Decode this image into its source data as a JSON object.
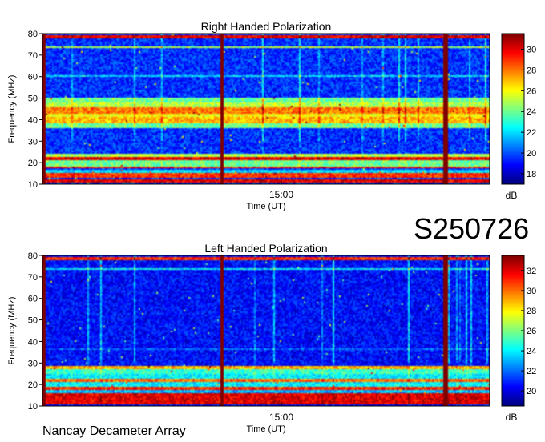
{
  "station_code": "S250726",
  "instrument": "Nancay Decameter Array",
  "chart_data": [
    {
      "type": "heatmap",
      "title": "Right Handed Polarization",
      "xlabel": "Time (UT)",
      "ylabel": "Frequency (MHz)",
      "x_ticks": [
        "15:00"
      ],
      "ylim": [
        10,
        80
      ],
      "y_ticks": [
        10,
        20,
        30,
        40,
        50,
        60,
        70,
        80
      ],
      "colorbar": {
        "label": "dB",
        "ticks": [
          18,
          20,
          22,
          24,
          26,
          28,
          30
        ],
        "range": [
          17,
          31.5
        ]
      },
      "bands": [
        {
          "freq": [
            10.5,
            12.5
          ],
          "level": 30
        },
        {
          "freq": [
            13,
            15
          ],
          "level": 29
        },
        {
          "freq": [
            15,
            17
          ],
          "level": 22
        },
        {
          "freq": [
            17.5,
            18.5
          ],
          "level": 29
        },
        {
          "freq": [
            18.5,
            21
          ],
          "level": 24
        },
        {
          "freq": [
            21,
            22.5
          ],
          "level": 30
        },
        {
          "freq": [
            22.5,
            24
          ],
          "level": 25
        },
        {
          "freq": [
            36,
            38
          ],
          "level": 24
        },
        {
          "freq": [
            38,
            41
          ],
          "level": 27
        },
        {
          "freq": [
            41,
            43
          ],
          "level": 26
        },
        {
          "freq": [
            43,
            46
          ],
          "level": 28
        },
        {
          "freq": [
            46,
            48
          ],
          "level": 25
        },
        {
          "freq": [
            48,
            50
          ],
          "level": 24
        },
        {
          "freq": [
            60,
            61
          ],
          "level": 22
        },
        {
          "freq": [
            73,
            74
          ],
          "level": 25
        },
        {
          "freq": [
            78,
            79.5
          ],
          "level": 30
        }
      ],
      "background_level": 19.5,
      "bursts": [
        0.4,
        0.9
      ]
    },
    {
      "type": "heatmap",
      "title": "Left Handed Polarization",
      "xlabel": "Time (UT)",
      "ylabel": "Frequency (MHz)",
      "x_ticks": [
        "15:00"
      ],
      "ylim": [
        10,
        80
      ],
      "y_ticks": [
        10,
        20,
        30,
        40,
        50,
        60,
        70,
        80
      ],
      "colorbar": {
        "label": "dB",
        "ticks": [
          20,
          22,
          24,
          26,
          28,
          30,
          32
        ],
        "range": [
          18.5,
          33.5
        ]
      },
      "bands": [
        {
          "freq": [
            10.5,
            13
          ],
          "level": 32
        },
        {
          "freq": [
            13,
            16
          ],
          "level": 32
        },
        {
          "freq": [
            16,
            17.5
          ],
          "level": 23
        },
        {
          "freq": [
            17.5,
            19
          ],
          "level": 31
        },
        {
          "freq": [
            19,
            21
          ],
          "level": 24
        },
        {
          "freq": [
            21,
            22.5
          ],
          "level": 30
        },
        {
          "freq": [
            22.5,
            25
          ],
          "level": 24
        },
        {
          "freq": [
            25,
            27.5
          ],
          "level": 25
        },
        {
          "freq": [
            27.5,
            28.5
          ],
          "level": 29
        },
        {
          "freq": [
            36,
            37
          ],
          "level": 22
        },
        {
          "freq": [
            73,
            74
          ],
          "level": 24
        },
        {
          "freq": [
            78,
            79.5
          ],
          "level": 31
        }
      ],
      "background_level": 20.5,
      "bursts": [
        0.4,
        0.9
      ]
    }
  ],
  "colormap": [
    "#00007f",
    "#0000ff",
    "#007fff",
    "#00ffff",
    "#7fff7f",
    "#ffff00",
    "#ff7f00",
    "#ff0000",
    "#7f0000"
  ]
}
